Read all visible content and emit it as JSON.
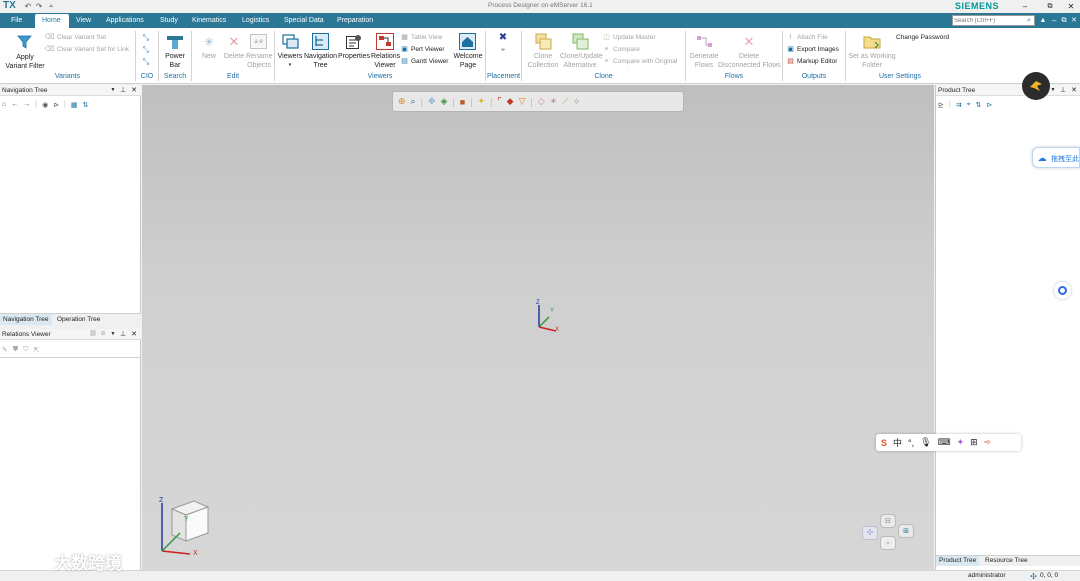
{
  "titlebar": {
    "logo": "TX",
    "title": "Process Designer on eMServer 16.1",
    "brand": "SIEMENS"
  },
  "menu": {
    "file": "File",
    "tabs": [
      "Home",
      "View",
      "Applications",
      "Study",
      "Kinematics",
      "Logistics",
      "Special Data",
      "Preparation"
    ],
    "search_placeholder": "Search (Ctrl+F)"
  },
  "ribbon": {
    "variants": {
      "apply_line1": "Apply",
      "apply_line2": "Variant Filter",
      "clear_set": "Clear Variant Set",
      "clear_set_link": "Clear Variant Set for Link",
      "group": "Variants"
    },
    "cio": {
      "group": "CIO"
    },
    "search": {
      "line1": "Power",
      "line2": "Bar",
      "group": "Search"
    },
    "edit": {
      "new": "New",
      "delete": "Delete",
      "rename1": "Rename",
      "rename2": "Objects",
      "group": "Edit"
    },
    "viewers": {
      "viewers": "Viewers",
      "nav1": "Navigation",
      "nav2": "Tree",
      "properties": "Properties",
      "rel1": "Relations",
      "rel2": "Viewer",
      "table_view": "Table View",
      "pert": "Pert Viewer",
      "gantt": "Gantt Viewer",
      "welcome1": "Welcome",
      "welcome2": "Page",
      "group": "Viewers"
    },
    "placement": {
      "group": "Placement"
    },
    "clone": {
      "clone1": "Clone",
      "clone2": "Collection",
      "cua1": "Clone/Update",
      "cua2": "Alternative",
      "update_master": "Update Master",
      "compare": "Compare",
      "compare_original": "Compare with Original",
      "group": "Clone"
    },
    "flows": {
      "gen1": "Generate",
      "gen2": "Flows",
      "del1": "Delete",
      "del2": "Disconnected Flows",
      "group": "Flows"
    },
    "outputs": {
      "attach": "Attach File",
      "export": "Export Images",
      "markup": "Markup Editor",
      "group": "Outputs"
    },
    "user": {
      "set1": "Set as Working",
      "set2": "Folder",
      "change_password": "Change Password",
      "group": "User Settings"
    }
  },
  "panels": {
    "nav_tree": {
      "title": "Navigation Tree",
      "tabs": [
        "Navigation Tree",
        "Operation Tree"
      ]
    },
    "relations": {
      "title": "Relations Viewer"
    },
    "product_tree": {
      "title": "Product Tree",
      "tabs": [
        "Product Tree",
        "Resource Tree"
      ]
    }
  },
  "viewport": {
    "axes": {
      "x": "X",
      "y": "Y",
      "z": "Z"
    }
  },
  "overlay": {
    "side_widget": "拖拽至此",
    "ime_chars": [
      "中"
    ],
    "watermark": "大数跨境"
  },
  "statusbar": {
    "user": "administrator",
    "coords": "0, 0, 0"
  },
  "colors": {
    "menubar": "#2a7896",
    "accent": "#009999",
    "viewport": "#c8c8c8"
  }
}
